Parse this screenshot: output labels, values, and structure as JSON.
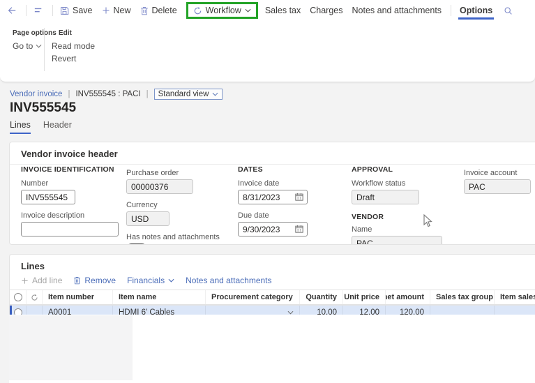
{
  "colors": {
    "accent_blue": "#4a6cb8",
    "active_underline": "#3e64c8",
    "workflow_highlight_green": "#23a327",
    "selected_row_bg": "#dbe6f8"
  },
  "toolbar": {
    "save": "Save",
    "new": "New",
    "delete": "Delete",
    "workflow": "Workflow",
    "sales_tax": "Sales tax",
    "charges": "Charges",
    "notes_and_attachments": "Notes and attachments",
    "options": "Options"
  },
  "options_menu": {
    "page_options_group": {
      "title": "Page options",
      "go_to": "Go to"
    },
    "edit_group": {
      "title": "Edit",
      "read_mode": "Read mode",
      "revert": "Revert"
    }
  },
  "breadcrumb": {
    "link": "Vendor invoice",
    "separator": "|",
    "record": "INV555545 : PACI",
    "view_selector": "Standard view"
  },
  "page": {
    "title": "INV555545",
    "tabs": {
      "lines": "Lines",
      "header": "Header"
    }
  },
  "invoice_header": {
    "title": "Vendor invoice header",
    "invoice_identification": {
      "group_title": "INVOICE IDENTIFICATION",
      "number_label": "Number",
      "number_value": "INV555545",
      "description_label": "Invoice description",
      "description_value": ""
    },
    "purchase": {
      "purchase_order_label": "Purchase order",
      "purchase_order_value": "00000376",
      "currency_label": "Currency",
      "currency_value": "USD",
      "has_notes_label": "Has notes and attachments",
      "has_notes_value": "No"
    },
    "dates": {
      "group_title": "DATES",
      "invoice_date_label": "Invoice date",
      "invoice_date_value": "8/31/2023",
      "due_date_label": "Due date",
      "due_date_value": "9/30/2023"
    },
    "approval": {
      "group_title": "APPROVAL",
      "workflow_status_label": "Workflow status",
      "workflow_status_value": "Draft"
    },
    "vendor": {
      "group_title": "VENDOR",
      "name_label": "Name",
      "name_value": "PAC"
    },
    "invoice_account": {
      "label": "Invoice account",
      "value": "PAC"
    }
  },
  "lines": {
    "title": "Lines",
    "toolbar": {
      "add_line": "Add line",
      "remove": "Remove",
      "financials": "Financials",
      "notes_and_attachments": "Notes and attachments"
    },
    "table": {
      "headers": [
        "Item number",
        "Item name",
        "Procurement category",
        "Quantity",
        "Unit price",
        "Line net amount",
        "Sales tax group",
        "Item sales tax group"
      ],
      "rows": [
        {
          "item_number": "A0001",
          "item_name": "HDMI 6' Cables",
          "procurement_category": "",
          "quantity": "10.00",
          "unit_price": "12.00",
          "line_net_amount": "120.00",
          "sales_tax_group": "",
          "item_sales_tax_group": ""
        }
      ]
    }
  }
}
